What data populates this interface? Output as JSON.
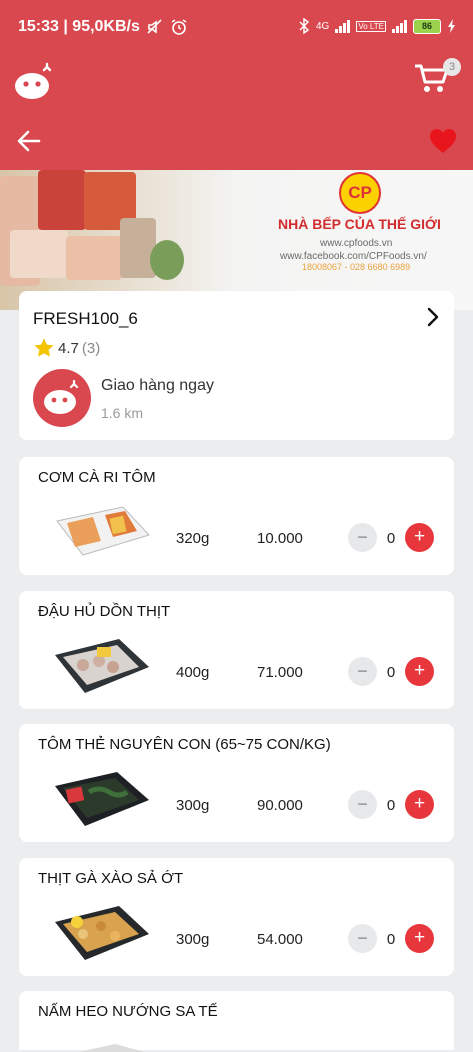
{
  "status_bar": {
    "time_speed": "15:33 | 95,0KB/s",
    "network_label": "4G",
    "volte_label": "Vo LTE",
    "battery": "86"
  },
  "header": {
    "cart_count": "3",
    "brand_color": "#d9484e"
  },
  "banner": {
    "cp_logo_text": "CP",
    "title": "NHÀ BẾP CỦA THẾ GIỚI",
    "website": "www.cpfoods.vn",
    "facebook": "www.facebook.com/CPFoods.vn/",
    "phone": "18008067 - 028 6680 6989"
  },
  "store": {
    "name": "FRESH100_6",
    "rating": "4.7",
    "rating_count": "(3)",
    "delivery": "Giao hàng ngay",
    "distance": "1.6 km"
  },
  "products": [
    {
      "name": "CƠM CÀ RI TÔM",
      "weight": "320g",
      "price": "10.000",
      "qty": "0"
    },
    {
      "name": "ĐẬU HỦ DỒN THỊT",
      "weight": "400g",
      "price": "71.000",
      "qty": "0"
    },
    {
      "name": "TÔM THẺ NGUYÊN CON (65~75 CON/KG)",
      "weight": "300g",
      "price": "90.000",
      "qty": "0"
    },
    {
      "name": "THỊT GÀ XÀO SẢ ỚT",
      "weight": "300g",
      "price": "54.000",
      "qty": "0"
    },
    {
      "name": "NẤM HEO NƯỚNG SA TẾ"
    }
  ],
  "controls": {
    "minus": "−",
    "plus": "+"
  },
  "accent_color": "#e8373c"
}
